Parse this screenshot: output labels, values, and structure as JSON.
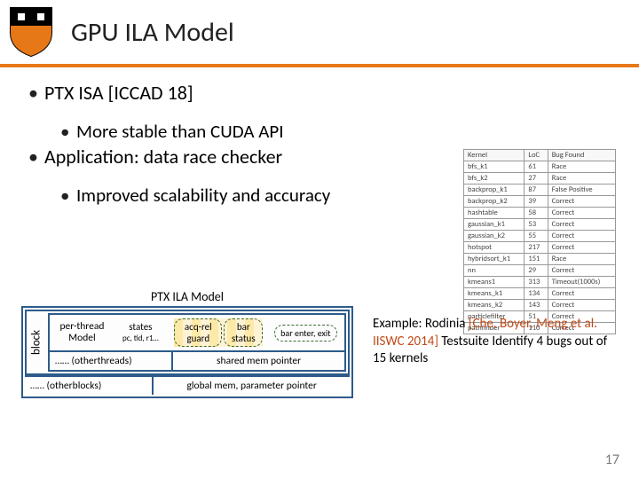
{
  "header": {
    "title": "GPU ILA Model"
  },
  "bullets": {
    "b1": "PTX ISA [ICCAD 18]",
    "b1a": "More stable than CUDA API",
    "b2": "Application: data race checker",
    "b2a": "Improved scalability and accuracy"
  },
  "table": {
    "head": [
      "Kernel",
      "LoC",
      "Bug Found"
    ],
    "rows": [
      [
        "bfs_k1",
        "61",
        "Race"
      ],
      [
        "bfs_k2",
        "27",
        "Race"
      ],
      [
        "backprop_k1",
        "87",
        "False Positive"
      ],
      [
        "backprop_k2",
        "39",
        "Correct"
      ],
      [
        "hashtable",
        "58",
        "Correct"
      ],
      [
        "gaussian_k1",
        "53",
        "Correct"
      ],
      [
        "gaussian_k2",
        "55",
        "Correct"
      ],
      [
        "hotspot",
        "217",
        "Correct"
      ],
      [
        "hybridsort_k1",
        "151",
        "Race"
      ],
      [
        "nn",
        "29",
        "Correct"
      ],
      [
        "kmeans1",
        "313",
        "Timeout(1000s)"
      ],
      [
        "kmeans_k1",
        "134",
        "Correct"
      ],
      [
        "kmeans_k2",
        "143",
        "Correct"
      ],
      [
        "particlefilter",
        "51",
        "Correct"
      ],
      [
        "pathfinder",
        "110",
        "Correct"
      ]
    ]
  },
  "diagram": {
    "title": "PTX ILA Model",
    "block_label": "block",
    "pt_line1": "per-thread",
    "pt_line2": "Model",
    "states_line1": "states",
    "states_line2": "pc, tid, r1…",
    "acq_rel": "acq-rel guard",
    "bar_status": "bar status",
    "bar_enter": "bar enter, exit",
    "other_threads": "…… (otherthreads)",
    "shared_mem": "shared mem pointer",
    "other_blocks": "…… (otherblocks)",
    "global_mem": "global mem, parameter pointer"
  },
  "example": {
    "pre": "Example: Rodinia ",
    "cite": "[Che, Boyer, Meng et al. IISWC 2014]",
    "post": " Testsuite Identify 4 bugs out of 15 kernels"
  },
  "page_num": "17"
}
